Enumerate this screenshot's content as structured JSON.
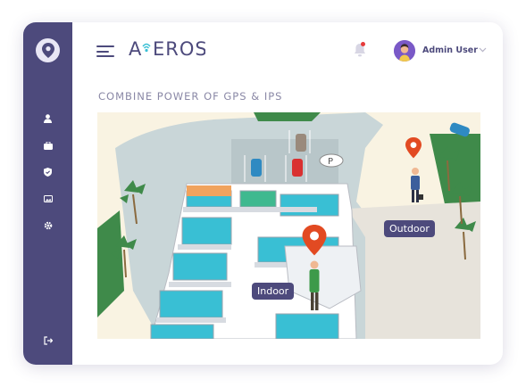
{
  "brand": {
    "logo_text": "A•EROS"
  },
  "header": {
    "user_name": "Admin User",
    "notification_dot": true
  },
  "sidebar": {
    "items": [
      {
        "icon": "user-icon"
      },
      {
        "icon": "briefcase-icon"
      },
      {
        "icon": "shield-icon"
      },
      {
        "icon": "image-icon"
      },
      {
        "icon": "gear-icon"
      },
      {
        "icon": "logout-icon"
      }
    ]
  },
  "main": {
    "title": "COMBINE POWER OF GPS & IPS",
    "map": {
      "indoor_label": "Indoor",
      "outdoor_label": "Outdoor",
      "parking_label": "P"
    }
  },
  "colors": {
    "sidebar": "#4d4a7c",
    "accent_pin": "#e24a22",
    "floor": "#ffffff",
    "rooms": "#39bfd4",
    "background_map": "#f9f3e2",
    "road": "#c9d6d8"
  }
}
